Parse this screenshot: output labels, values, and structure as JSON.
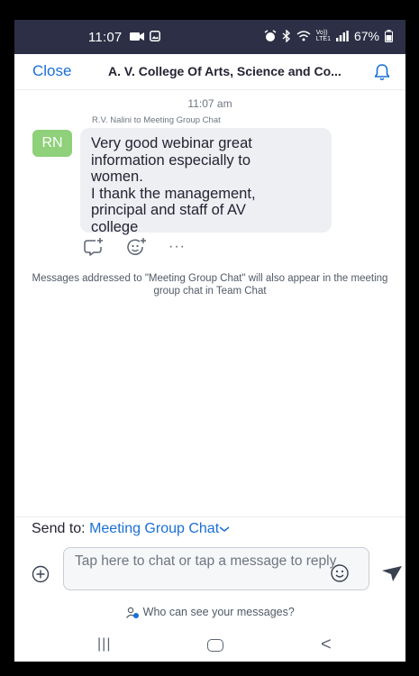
{
  "status_bar": {
    "time": "11:07",
    "network_label": "Vo))\nLTE1",
    "battery": "67%"
  },
  "header": {
    "close_label": "Close",
    "title": "A. V. College Of Arts, Science and Co..."
  },
  "messages": {
    "timestamp": "11:07 am",
    "sender_line": "R.V. Nalini to Meeting Group Chat",
    "avatar_initials": "RN",
    "avatar_color": "#8fd07a",
    "bubble_lines": [
      "Very good webinar great",
      "information especially to",
      "women.",
      "I thank the management,",
      "principal and staff of AV",
      "college"
    ],
    "more_label": "···"
  },
  "notice": "Messages addressed to \"Meeting Group Chat\" will also appear in the meeting group chat in Team Chat",
  "composer": {
    "send_to_label": "Send to:",
    "send_to_target": "Meeting Group Chat",
    "input_placeholder": "Tap here to chat or tap a message to reply",
    "who_label": "Who can see your messages?"
  },
  "nav": {
    "recent_glyph": "|||",
    "back_glyph": "<"
  },
  "colors": {
    "accent": "#1a6fd6",
    "status_bar": "#2c2f45"
  }
}
